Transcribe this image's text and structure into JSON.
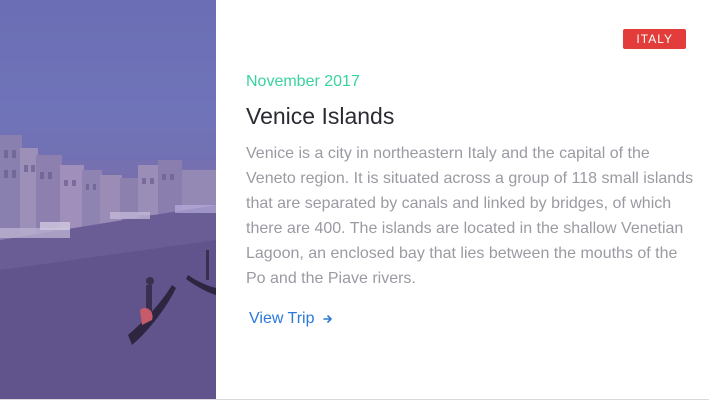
{
  "card": {
    "image_alt": "Venice canal with gondola",
    "badge": "ITALY",
    "date": "November 2017",
    "title": "Venice Islands",
    "description": "Venice is a city in northeastern Italy and the capital of the Veneto region. It is situated across a group of 118 small islands that are separated by canals and linked by bridges, of which there are 400. The islands are located in the shallow Venetian Lagoon, an enclosed bay that lies between the mouths of the Po and the Piave rivers.",
    "link_label": "View Trip",
    "link_icon": "arrow-right-icon"
  },
  "colors": {
    "badge_bg": "#e23d3a",
    "date": "#3ad29f",
    "link": "#2b79d9",
    "photo_overlay": "#6a6db2"
  }
}
